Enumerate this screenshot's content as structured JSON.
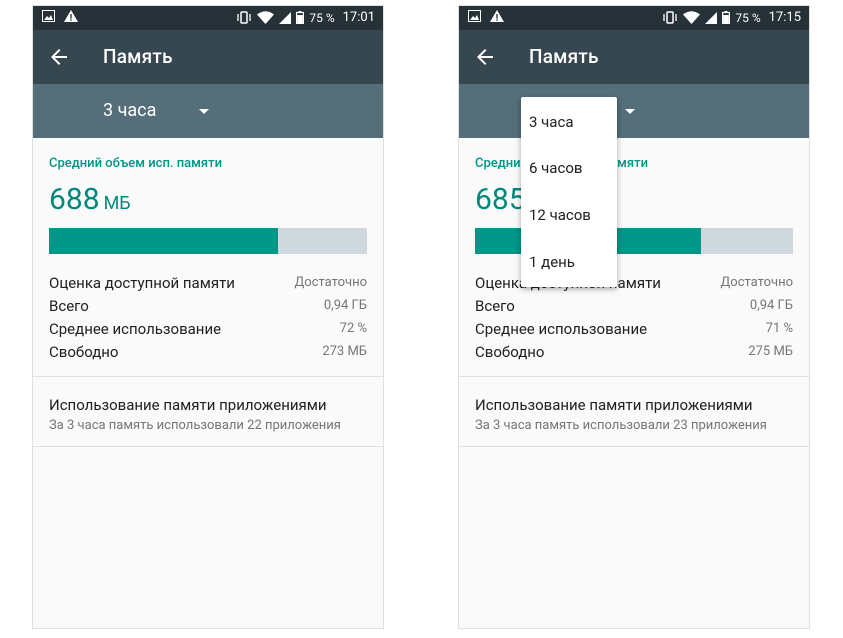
{
  "screens": [
    {
      "status": {
        "battery": "75 %",
        "time": "17:01"
      },
      "title": "Память",
      "spinner_value": "3 часа",
      "avg_label": "Средний объем исп. памяти",
      "avg_value": "688",
      "avg_unit": "МБ",
      "usage_fraction": 0.72,
      "stats": [
        {
          "label": "Оценка доступной памяти",
          "value": "Достаточно"
        },
        {
          "label": "Всего",
          "value": "0,94 ГБ"
        },
        {
          "label": "Среднее использование",
          "value": "72 %"
        },
        {
          "label": "Свободно",
          "value": "273 МБ"
        }
      ],
      "apps_title": "Использование памяти приложениями",
      "apps_subtitle": "За 3 часа память использовали 22 приложения"
    },
    {
      "status": {
        "battery": "75 %",
        "time": "17:15"
      },
      "title": "Память",
      "spinner_value": "",
      "avg_label": "Средний объем исп. памяти",
      "avg_value": "685",
      "avg_unit": "МБ",
      "usage_fraction": 0.71,
      "stats": [
        {
          "label": "Оценка доступной памяти",
          "value": "Достаточно"
        },
        {
          "label": "Всего",
          "value": "0,94 ГБ"
        },
        {
          "label": "Среднее использование",
          "value": "71 %"
        },
        {
          "label": "Свободно",
          "value": "275 МБ"
        }
      ],
      "apps_title": "Использование памяти приложениями",
      "apps_subtitle": "За 3 часа память использовали 23 приложения",
      "dropdown_options": [
        "3 часа",
        "6 часов",
        "12 часов",
        "1 день"
      ]
    }
  ],
  "colors": {
    "statusbar": "#263238",
    "appbar": "#37474f",
    "spinnerbar": "#546e7a",
    "accent": "#009688"
  },
  "icons": [
    "image-icon",
    "warning-icon",
    "vibrate-icon",
    "wifi-icon",
    "signal-icon",
    "battery-icon",
    "back-arrow-icon",
    "dropdown-arrow-icon"
  ]
}
